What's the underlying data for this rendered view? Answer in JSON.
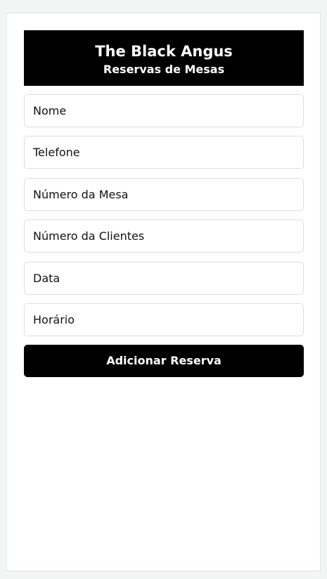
{
  "header": {
    "title": "The Black Angus",
    "subtitle": "Reservas de Mesas"
  },
  "form": {
    "fields": [
      {
        "placeholder": "Nome",
        "value": ""
      },
      {
        "placeholder": "Telefone",
        "value": ""
      },
      {
        "placeholder": "Número da Mesa",
        "value": ""
      },
      {
        "placeholder": "Número da Clientes",
        "value": ""
      },
      {
        "placeholder": "Data",
        "value": ""
      },
      {
        "placeholder": "Horário",
        "value": ""
      }
    ],
    "submit_label": "Adicionar Reserva"
  },
  "colors": {
    "header_bg": "#000000",
    "button_bg": "#000000",
    "page_bg": "#f3f4f4",
    "card_bg": "#ffffff",
    "field_border": "#dedede"
  }
}
